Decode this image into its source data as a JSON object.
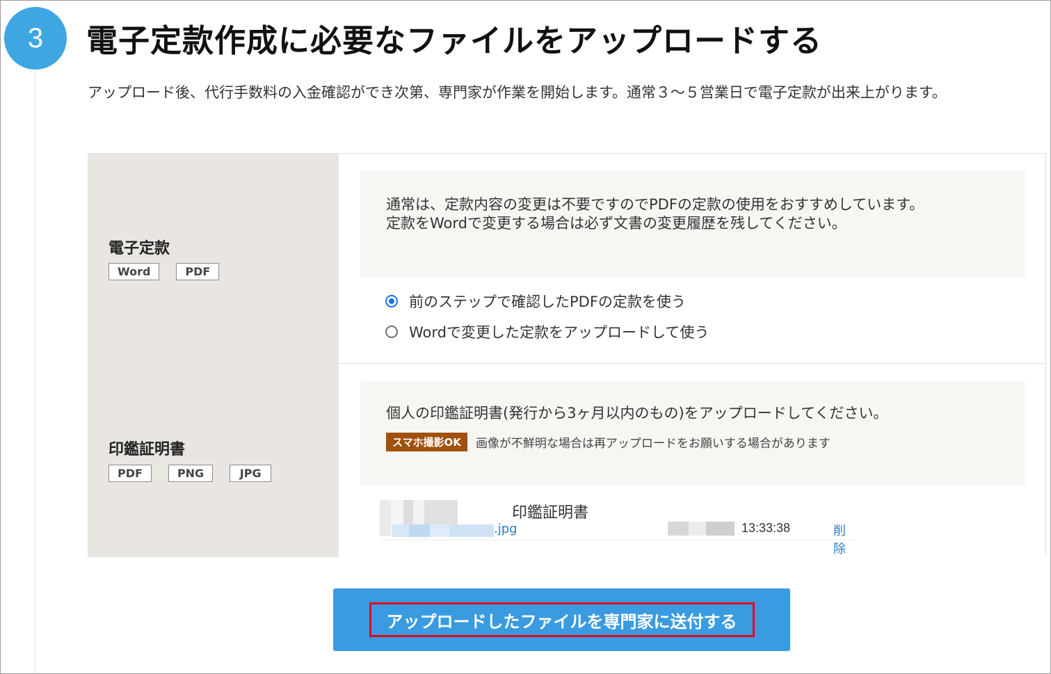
{
  "step": {
    "number": "3",
    "title": "電子定款作成に必要なファイルをアップロードする",
    "intro": "アップロード後、代行手数料の入金確認ができ次第、専門家が作業を開始します。通常３～５営業日で電子定款が出来上がります。"
  },
  "rows": [
    {
      "label": "電子定款",
      "tags": [
        "Word",
        "PDF"
      ],
      "notice_line1": "通常は、定款内容の変更は不要ですのでPDFの定款の使用をおすすめしています。",
      "notice_line2": "定款をWordで変更する場合は必ず文書の変更履歴を残してください。",
      "options": [
        {
          "label": "前のステップで確認したPDFの定款を使う",
          "checked": true
        },
        {
          "label": "Wordで変更した定款をアップロードして使う",
          "checked": false
        }
      ]
    },
    {
      "label": "印鑑証明書",
      "tags": [
        "PDF",
        "PNG",
        "JPG"
      ],
      "notice": "個人の印鑑証明書(発行から3ヶ月以内のもの)をアップロードしてください。",
      "smart_badge": "スマホ撮影OK",
      "smart_text": "画像が不鮮明な場合は再アップロードをお願いする場合があります",
      "file": {
        "ext": ".jpg",
        "label": "印鑑証明書",
        "time": "13:33:38",
        "delete": "削除"
      }
    }
  ],
  "submit_label": "アップロードしたファイルを専門家に送付する",
  "colors": {
    "accent": "#3ea6e0",
    "button": "#3a9be0",
    "highlight": "#e8001c",
    "label_bg": "#e9e6e2",
    "notice_bg": "#f8f6f3",
    "smart_badge": "#a0510d",
    "link": "#2b7cc0"
  }
}
